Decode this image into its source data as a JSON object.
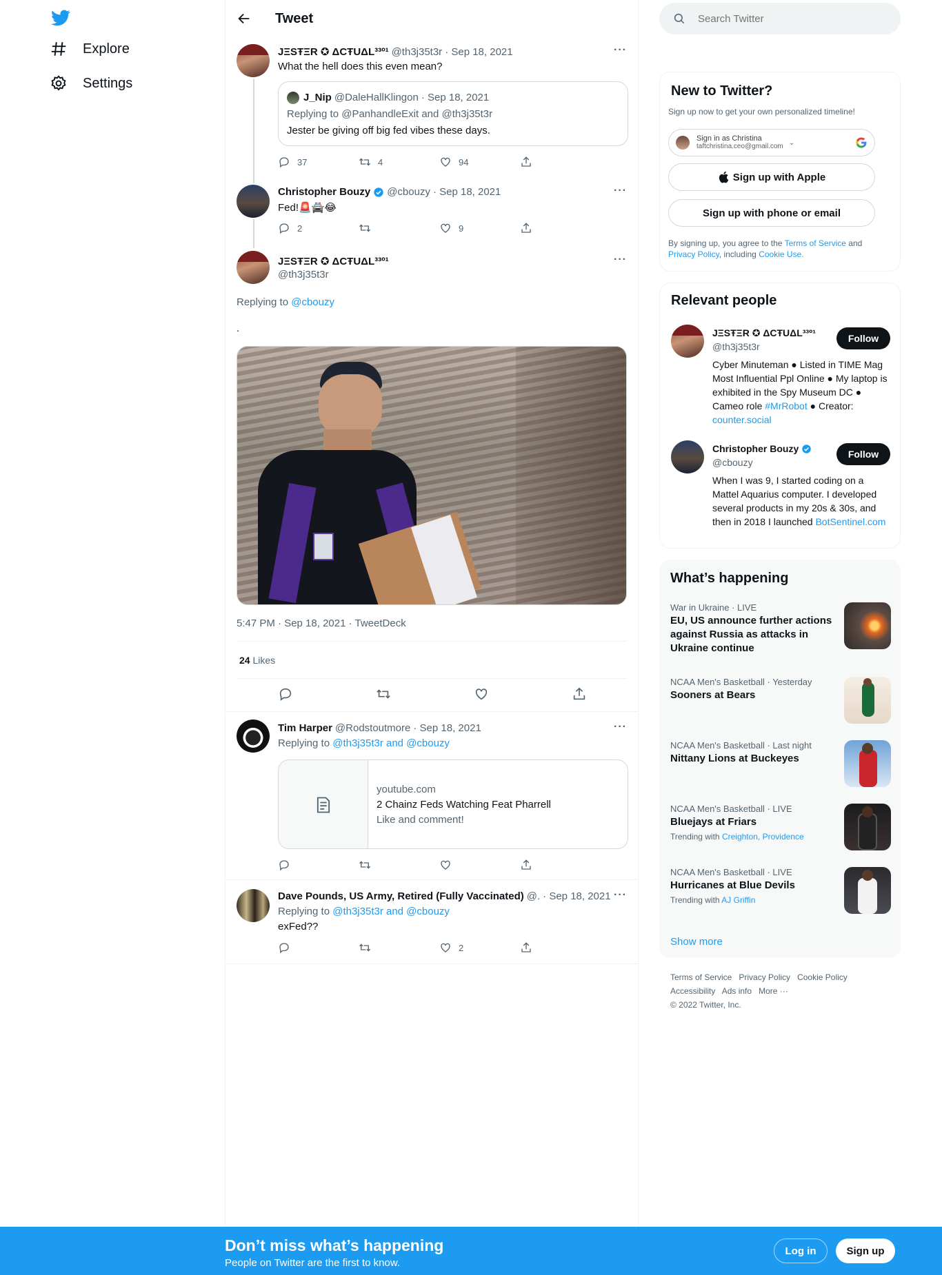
{
  "nav": {
    "explore_label": "Explore",
    "settings_label": "Settings"
  },
  "header": {
    "title": "Tweet"
  },
  "tweets": {
    "t1": {
      "name": "JΞSŦΞR ✪ ΔCŦUΔL³³º¹",
      "handle": "@th3j35t3r",
      "date": "· Sep 18, 2021",
      "text": "What the hell does this even mean?",
      "quote": {
        "name": "J_Nip",
        "handle": "@DaleHallKlingon",
        "date": "· Sep 18, 2021",
        "replying": "Replying to @PanhandleExit and @th3j35t3r",
        "text": "Jester be giving off big fed vibes these days."
      },
      "replies": "37",
      "retweets": "4",
      "likes": "94"
    },
    "t2": {
      "name": "Christopher Bouzy",
      "handle": "@cbouzy",
      "date": "· Sep 18, 2021",
      "text": "Fed!🚨🚔😂",
      "replies": "2",
      "retweets": "",
      "likes": "9"
    },
    "main": {
      "name": "JΞSŦΞR ✪ ΔCŦUΔL³³º¹",
      "handle": "@th3j35t3r",
      "replying_prefix": "Replying to",
      "replying_to": "@cbouzy",
      "text": ".",
      "timestamp": "5:47 PM · Sep 18, 2021 · TweetDeck",
      "likes_count": "24",
      "likes_label": "Likes"
    },
    "r1": {
      "name": "Tim Harper",
      "handle": "@Rodstoutmore",
      "date": "· Sep 18, 2021",
      "replying_prefix": "Replying to",
      "replying_to": "@th3j35t3r and @cbouzy",
      "card": {
        "domain": "youtube.com",
        "title": "2 Chainz Feds Watching Feat Pharrell",
        "desc": "Like and comment!"
      }
    },
    "r2": {
      "name": "Dave Pounds, US Army, Retired (Fully Vaccinated)",
      "handle": "@.",
      "date": "· Sep 18, 2021",
      "replying_prefix": "Replying to",
      "replying_to": "@th3j35t3r and @cbouzy",
      "text": "exFed??",
      "likes": "2"
    }
  },
  "search": {
    "placeholder": "Search Twitter"
  },
  "signup": {
    "title": "New to Twitter?",
    "subtitle": "Sign up now to get your own personalized timeline!",
    "google_name": "Sign in as Christina",
    "google_email": "taftchristina.ceo@gmail.com",
    "apple_label": "Sign up with Apple",
    "phone_label": "Sign up with phone or email",
    "legal_1": "By signing up, you agree to the",
    "legal_tos": "Terms of Service",
    "legal_and": "and",
    "legal_pp": "Privacy Policy",
    "legal_incl": ", including",
    "legal_cookie": "Cookie Use."
  },
  "relevant": {
    "title": "Relevant people",
    "people": [
      {
        "name": "JΞSŦΞR ✪ ΔCŦUΔL³³º¹",
        "handle": "@th3j35t3r",
        "bio": "Cyber Minuteman ● Listed in TIME Mag Most Influential Ppl Online ● My laptop is exhibited in the Spy Museum DC ● Cameo role",
        "bio_link": "#MrRobot",
        "bio_2": "● Creator:",
        "bio_link2": "counter.social",
        "follow": "Follow"
      },
      {
        "name": "Christopher Bouzy",
        "handle": "@cbouzy",
        "bio": "When I was 9, I started coding on a Mattel Aquarius computer. I developed several products in my 20s & 30s, and then in 2018 I launched",
        "bio_link": "BotSentinel.com",
        "follow": "Follow"
      }
    ]
  },
  "happening": {
    "title": "What’s happening",
    "trends": [
      {
        "meta": "War in Ukraine · LIVE",
        "title": "EU, US announce further actions against Russia as attacks in Ukraine continue",
        "trending": "",
        "with": ""
      },
      {
        "meta": "NCAA Men's Basketball · Yesterday",
        "title": "Sooners at Bears",
        "trending": "",
        "with": ""
      },
      {
        "meta": "NCAA Men's Basketball · Last night",
        "title": "Nittany Lions at Buckeyes",
        "trending": "",
        "with": ""
      },
      {
        "meta": "NCAA Men's Basketball · LIVE",
        "title": "Bluejays at Friars",
        "trending": "Trending with",
        "with": "Creighton, Providence"
      },
      {
        "meta": "NCAA Men's Basketball · LIVE",
        "title": "Hurricanes at Blue Devils",
        "trending": "Trending with",
        "with": "AJ Griffin"
      }
    ],
    "show_more": "Show more"
  },
  "footer": {
    "links": [
      "Terms of Service",
      "Privacy Policy",
      "Cookie Policy",
      "Accessibility",
      "Ads info",
      "More ···"
    ],
    "copyright": "© 2022 Twitter, Inc."
  },
  "bottombar": {
    "title": "Don’t miss what’s happening",
    "subtitle": "People on Twitter are the first to know.",
    "login": "Log in",
    "signup": "Sign up"
  },
  "colors": {
    "accent": "#1d9bf0",
    "text": "#0f1419",
    "muted": "#536471"
  }
}
